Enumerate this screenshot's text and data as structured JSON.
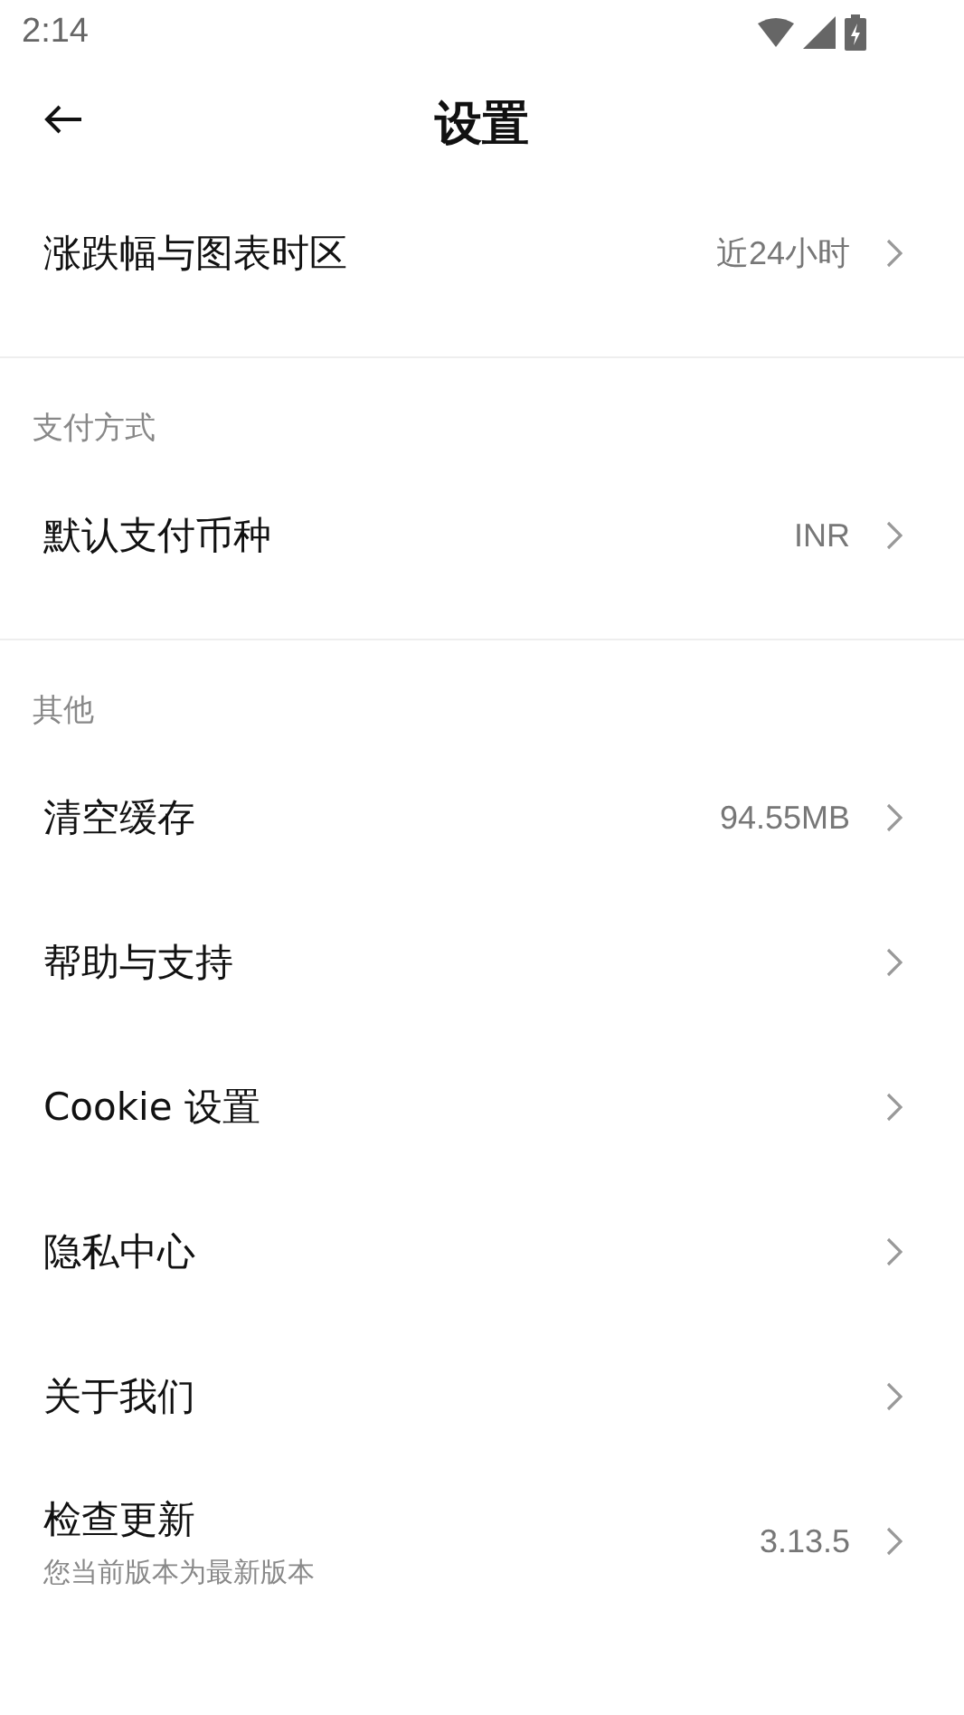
{
  "status_bar": {
    "time": "2:14"
  },
  "header": {
    "title": "设置"
  },
  "sections": [
    {
      "items": [
        {
          "label": "涨跌幅与图表时区",
          "value": "近24小时"
        }
      ]
    },
    {
      "title": "支付方式",
      "items": [
        {
          "label": "默认支付币种",
          "value": "INR"
        }
      ]
    },
    {
      "title": "其他",
      "items": [
        {
          "label": "清空缓存",
          "value": "94.55MB"
        },
        {
          "label": "帮助与支持"
        },
        {
          "label": "Cookie 设置"
        },
        {
          "label": "隐私中心"
        },
        {
          "label": "关于我们"
        },
        {
          "label": "检查更新",
          "value": "3.13.5",
          "sub": "您当前版本为最新版本"
        }
      ]
    }
  ]
}
